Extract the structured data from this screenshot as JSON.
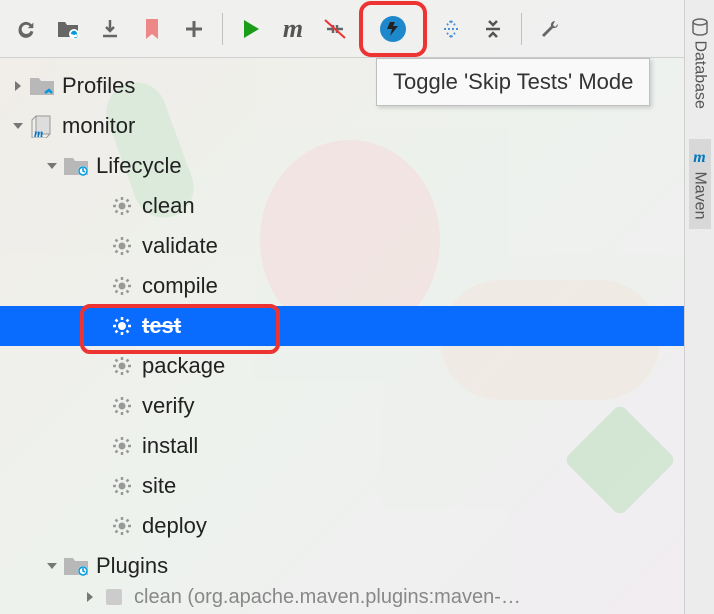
{
  "toolbar": {
    "skip_tests_tooltip": "Toggle 'Skip Tests' Mode"
  },
  "sidebar_right": {
    "database_label": "Database",
    "maven_label": "Maven"
  },
  "tree": {
    "profiles": {
      "label": "Profiles",
      "expanded": false
    },
    "monitor": {
      "label": "monitor",
      "expanded": true,
      "lifecycle": {
        "label": "Lifecycle",
        "expanded": true,
        "goals": [
          {
            "label": "clean",
            "selected": false,
            "skipped": false
          },
          {
            "label": "validate",
            "selected": false,
            "skipped": false
          },
          {
            "label": "compile",
            "selected": false,
            "skipped": false
          },
          {
            "label": "test",
            "selected": true,
            "skipped": true
          },
          {
            "label": "package",
            "selected": false,
            "skipped": false
          },
          {
            "label": "verify",
            "selected": false,
            "skipped": false
          },
          {
            "label": "install",
            "selected": false,
            "skipped": false
          },
          {
            "label": "site",
            "selected": false,
            "skipped": false
          },
          {
            "label": "deploy",
            "selected": false,
            "skipped": false
          }
        ]
      },
      "plugins": {
        "label": "Plugins",
        "expanded": true,
        "truncated_item": "clean (org.apache.maven.plugins:maven-…"
      }
    }
  },
  "colors": {
    "selection": "#0a6cff",
    "highlight_border": "#ee3333",
    "maven_accent": "#0099dd"
  }
}
